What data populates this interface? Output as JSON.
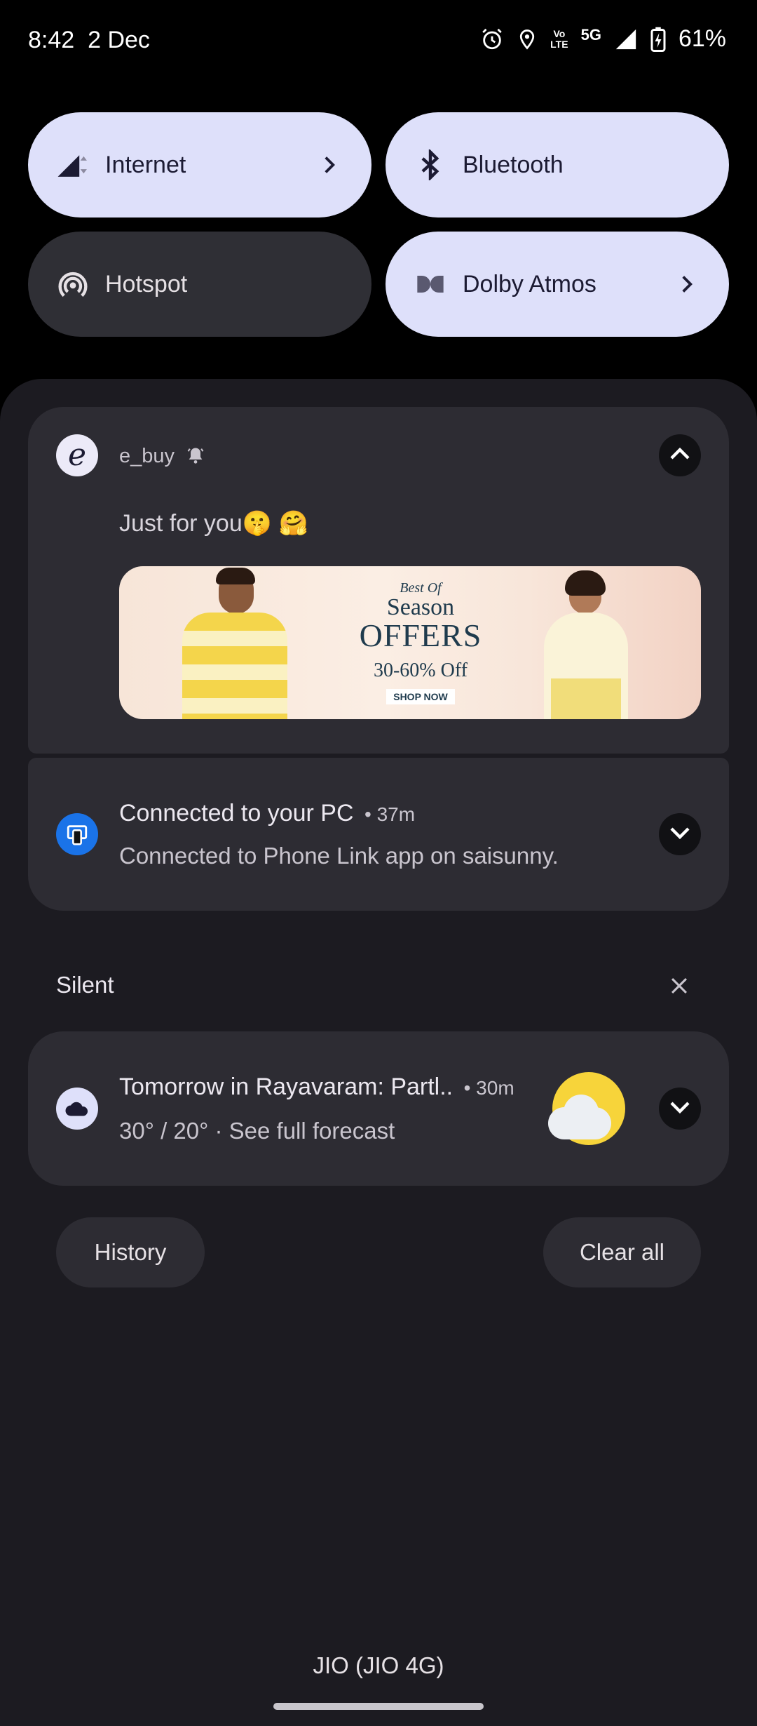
{
  "status_bar": {
    "time": "8:42",
    "date": "2 Dec",
    "volte_top": "Vo",
    "volte_bottom": "LTE",
    "network": "5G",
    "battery_percent": "61%",
    "icons": [
      "alarm-icon",
      "location-icon",
      "volte-icon",
      "signal-icon",
      "battery-charging-icon"
    ]
  },
  "quick_settings": {
    "tiles": [
      {
        "label": "Internet",
        "state": "on",
        "icon": "signal-icon"
      },
      {
        "label": "Bluetooth",
        "state": "on",
        "icon": "bluetooth-icon"
      },
      {
        "label": "Hotspot",
        "state": "off",
        "icon": "hotspot-icon"
      },
      {
        "label": "Dolby Atmos",
        "state": "on",
        "icon": "dolby-icon"
      }
    ]
  },
  "notifications": {
    "ebuy": {
      "app_name": "e_buy",
      "avatar_letter": "e",
      "message": "Just for you🤫 🤗",
      "promo": {
        "line1": "Best Of",
        "line2": "Season",
        "line3": "OFFERS",
        "discount": "30-60% Off",
        "cta": "SHOP NOW"
      }
    },
    "phone_link": {
      "title": "Connected to your PC",
      "time": "• 37m",
      "body": "Connected to Phone Link app on saisunny."
    },
    "silent_header": "Silent",
    "weather": {
      "title": "Tomorrow in Rayavaram: Partl..",
      "time": "• 30m",
      "body": "30° / 20° · See full forecast"
    }
  },
  "actions": {
    "history": "History",
    "clear_all": "Clear all"
  },
  "carrier": "JIO (JIO 4G)",
  "colors": {
    "tile_on": "#dee0fa",
    "tile_off": "#2f2f35",
    "shade_bg": "#1c1b21",
    "card_bg": "#2d2c33",
    "phone_link_blue": "#1a73e8"
  }
}
